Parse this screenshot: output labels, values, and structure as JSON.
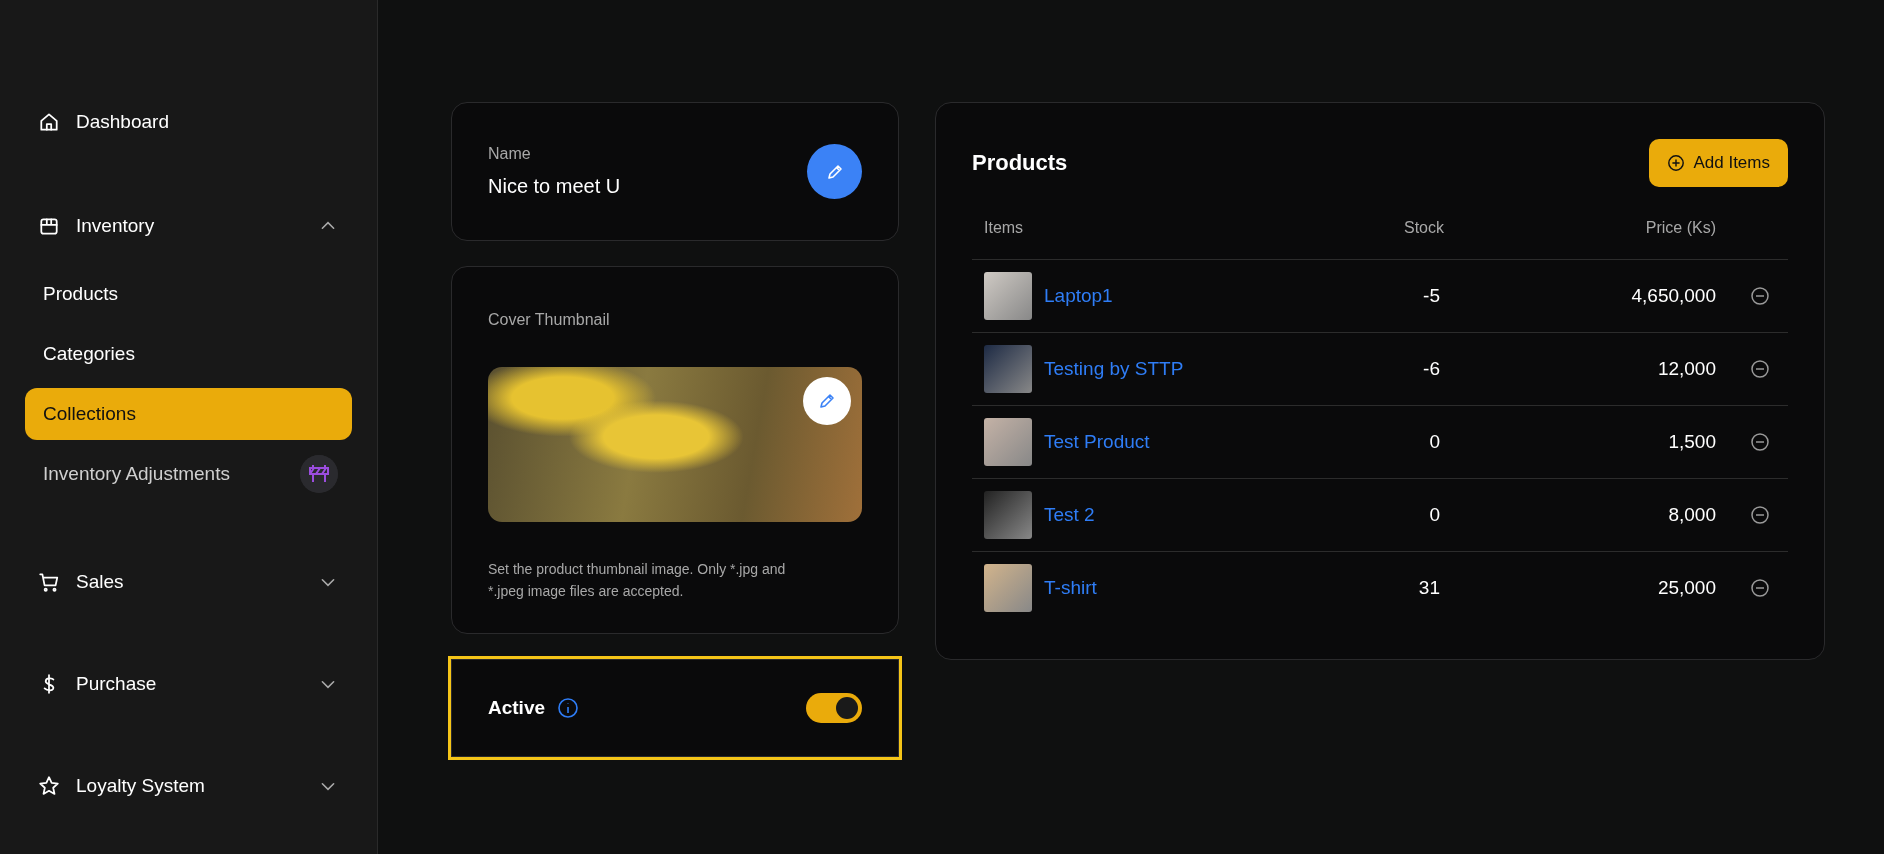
{
  "sidebar": {
    "items": [
      {
        "label": "Dashboard",
        "kind": "link"
      },
      {
        "label": "Inventory",
        "kind": "group",
        "expanded": true,
        "children": [
          {
            "label": "Products",
            "selected": false,
            "badge": false
          },
          {
            "label": "Categories",
            "selected": false,
            "badge": false
          },
          {
            "label": "Collections",
            "selected": true,
            "badge": false
          },
          {
            "label": "Inventory Adjustments",
            "selected": false,
            "badge": true
          }
        ]
      },
      {
        "label": "Sales",
        "kind": "group",
        "expanded": false
      },
      {
        "label": "Purchase",
        "kind": "group",
        "expanded": false
      },
      {
        "label": "Loyalty System",
        "kind": "group",
        "expanded": false
      }
    ]
  },
  "name_card": {
    "label": "Name",
    "value": "Nice to meet U"
  },
  "cover_card": {
    "label": "Cover Thumbnail",
    "hint": "Set the product thumbnail image. Only *.jpg and *.jpeg image files are accepted."
  },
  "active_card": {
    "label": "Active",
    "on": true,
    "focused": true
  },
  "products": {
    "title": "Products",
    "add_button": "Add Items",
    "columns": [
      "Items",
      "Stock",
      "Price (Ks)"
    ],
    "rows": [
      {
        "name": "Laptop1",
        "stock": "-5",
        "price": "4,650,000"
      },
      {
        "name": "Testing by STTP",
        "stock": "-6",
        "price": "12,000"
      },
      {
        "name": "Test Product",
        "stock": "0",
        "price": "1,500"
      },
      {
        "name": "Test 2",
        "stock": "0",
        "price": "8,000"
      },
      {
        "name": "T-shirt",
        "stock": "31",
        "price": "25,000"
      }
    ]
  }
}
